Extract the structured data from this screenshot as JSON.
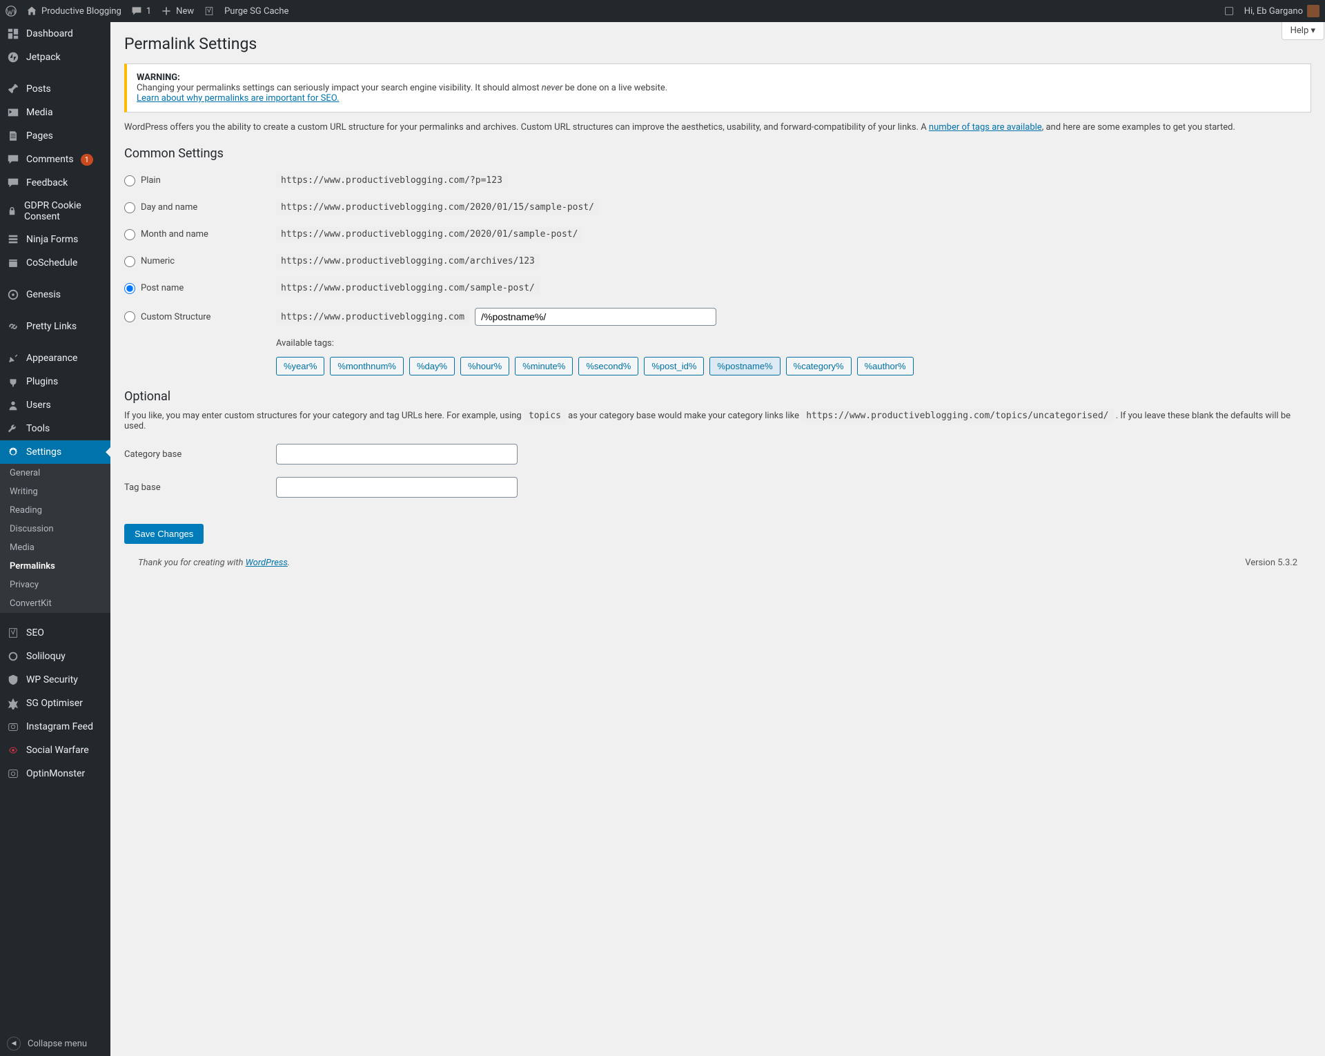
{
  "bar": {
    "site": "Productive Blogging",
    "comments": "1",
    "new": "New",
    "purge": "Purge SG Cache",
    "hi": "Hi, Eb Gargano"
  },
  "menu": [
    {
      "icon": "dash",
      "label": "Dashboard"
    },
    {
      "icon": "jet",
      "label": "Jetpack"
    },
    {
      "sep": true
    },
    {
      "icon": "pin",
      "label": "Posts"
    },
    {
      "icon": "media",
      "label": "Media"
    },
    {
      "icon": "page",
      "label": "Pages"
    },
    {
      "icon": "chat",
      "label": "Comments",
      "badge": "1"
    },
    {
      "icon": "chat",
      "label": "Feedback"
    },
    {
      "icon": "lock",
      "label": "GDPR Cookie Consent"
    },
    {
      "icon": "form",
      "label": "Ninja Forms"
    },
    {
      "icon": "cal",
      "label": "CoSchedule"
    },
    {
      "sep": true
    },
    {
      "icon": "gen",
      "label": "Genesis"
    },
    {
      "sep": true
    },
    {
      "icon": "link",
      "label": "Pretty Links"
    },
    {
      "sep": true
    },
    {
      "icon": "brush",
      "label": "Appearance"
    },
    {
      "icon": "plug",
      "label": "Plugins"
    },
    {
      "icon": "user",
      "label": "Users"
    },
    {
      "icon": "wrench",
      "label": "Tools"
    },
    {
      "icon": "gear",
      "label": "Settings",
      "active": true
    }
  ],
  "sub": [
    "General",
    "Writing",
    "Reading",
    "Discussion",
    "Media",
    "Permalinks",
    "Privacy",
    "ConvertKit"
  ],
  "subcur": "Permalinks",
  "menu2": [
    {
      "icon": "seo",
      "label": "SEO"
    },
    {
      "icon": "sol",
      "label": "Soliloquy"
    },
    {
      "icon": "shield",
      "label": "WP Security"
    },
    {
      "icon": "opt",
      "label": "SG Optimiser"
    },
    {
      "icon": "cam",
      "label": "Instagram Feed"
    },
    {
      "icon": "sw",
      "label": "Social Warfare"
    },
    {
      "icon": "ob",
      "label": "OptinMonster"
    }
  ],
  "collapse": "Collapse menu",
  "help": "Help ▾",
  "title": "Permalink Settings",
  "warn": {
    "h": "WARNING:",
    "t1": "Changing your permalinks settings can seriously impact your search engine visibility. It should almost ",
    "em": "never",
    "t2": " be done on a live website.",
    "link": "Learn about why permalinks are important for SEO."
  },
  "intro": {
    "t1": "WordPress offers you the ability to create a custom URL structure for your permalinks and archives. Custom URL structures can improve the aesthetics, usability, and forward-compatibility of your links. A ",
    "link": "number of tags are available",
    "t2": ", and here are some examples to get you started."
  },
  "h_common": "Common Settings",
  "opts": [
    {
      "label": "Plain",
      "ex": "https://www.productiveblogging.com/?p=123"
    },
    {
      "label": "Day and name",
      "ex": "https://www.productiveblogging.com/2020/01/15/sample-post/"
    },
    {
      "label": "Month and name",
      "ex": "https://www.productiveblogging.com/2020/01/sample-post/"
    },
    {
      "label": "Numeric",
      "ex": "https://www.productiveblogging.com/archives/123"
    },
    {
      "label": "Post name",
      "ex": "https://www.productiveblogging.com/sample-post/",
      "sel": true
    },
    {
      "label": "Custom Structure",
      "prefix": "https://www.productiveblogging.com",
      "val": "/%postname%/",
      "custom": true
    }
  ],
  "avtags_label": "Available tags:",
  "tags": [
    "%year%",
    "%monthnum%",
    "%day%",
    "%hour%",
    "%minute%",
    "%second%",
    "%post_id%",
    "%postname%",
    "%category%",
    "%author%"
  ],
  "tag_sel": "%postname%",
  "h_opt": "Optional",
  "opt_p": {
    "t1": "If you like, you may enter custom structures for your category and tag URLs here. For example, using ",
    "c1": "topics",
    "t2": " as your category base would make your category links like ",
    "c2": "https://www.productiveblogging.com/topics/uncategorised/",
    "t3": " . If you leave these blank the defaults will be used."
  },
  "cat_label": "Category base",
  "tag_label": "Tag base",
  "save": "Save Changes",
  "footer": {
    "t1": "Thank you for creating with ",
    "link": "WordPress",
    "t2": ".",
    "ver": "Version 5.3.2"
  }
}
